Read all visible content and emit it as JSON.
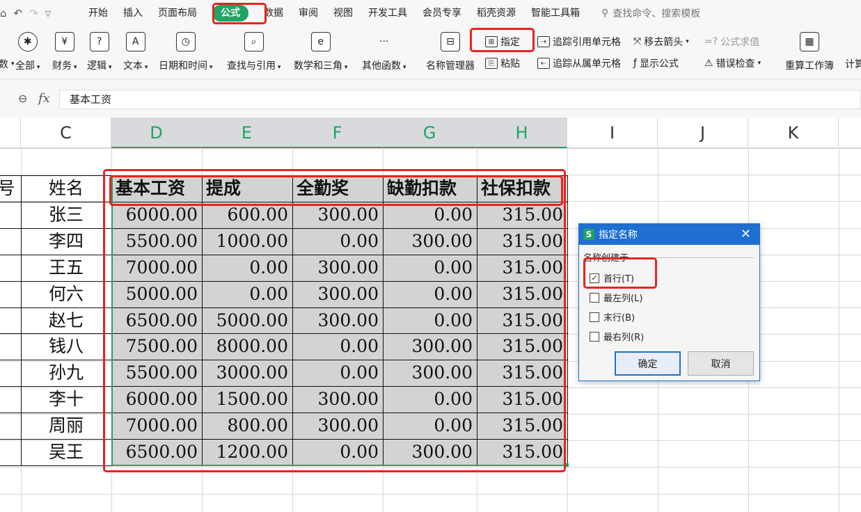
{
  "quick_access": {
    "icons": [
      "save-icon",
      "undo-icon",
      "redo-icon",
      "more-dropdown-icon"
    ]
  },
  "menu": {
    "tabs": [
      "开始",
      "插入",
      "页面布局",
      "公式",
      "数据",
      "审阅",
      "视图",
      "开发工具",
      "会员专享",
      "稻壳资源",
      "智能工具箱"
    ],
    "active_tab": "公式",
    "search_placeholder": "查找命令、搜索模板"
  },
  "ribbon": {
    "cut_label": "数",
    "function_buttons": [
      {
        "label": "全部",
        "icon": "✱"
      },
      {
        "label": "财务",
        "icon": "¥"
      },
      {
        "label": "逻辑",
        "icon": "?"
      },
      {
        "label": "文本",
        "icon": "A"
      },
      {
        "label": "日期和时间",
        "icon": "◷"
      },
      {
        "label": "查找与引用",
        "icon": "⌕"
      },
      {
        "label": "数学和三角",
        "icon": "e"
      },
      {
        "label": "其他函数",
        "icon": "···"
      }
    ],
    "name_manager": "名称管理器",
    "specify": "指定",
    "paste": "粘贴",
    "trace_precedents": "追踪引用单元格",
    "trace_dependents": "追踪从属单元格",
    "remove_arrows": "移去箭头",
    "show_formulas": "显示公式",
    "evaluate_formula": "公式求值",
    "error_check": "错误检查",
    "recalc": "重算工作簿",
    "calc_cut": "计算"
  },
  "formula_bar": {
    "fx": "fx",
    "value": "基本工资"
  },
  "columns": [
    "C",
    "D",
    "E",
    "F",
    "G",
    "H",
    "I",
    "J",
    "K"
  ],
  "sheet": {
    "col_b_header_cut": "号",
    "name_header": "姓名",
    "headers": [
      "基本工资",
      "提成",
      "全勤奖",
      "缺勤扣款",
      "社保扣款"
    ],
    "rows": [
      {
        "name": "张三",
        "vals": [
          "6000.00",
          "600.00",
          "300.00",
          "0.00",
          "315.00"
        ]
      },
      {
        "name": "李四",
        "vals": [
          "5500.00",
          "1000.00",
          "0.00",
          "300.00",
          "315.00"
        ]
      },
      {
        "name": "王五",
        "vals": [
          "7000.00",
          "0.00",
          "300.00",
          "0.00",
          "315.00"
        ]
      },
      {
        "name": "何六",
        "vals": [
          "5000.00",
          "0.00",
          "300.00",
          "0.00",
          "315.00"
        ]
      },
      {
        "name": "赵七",
        "vals": [
          "6500.00",
          "5000.00",
          "300.00",
          "0.00",
          "315.00"
        ]
      },
      {
        "name": "钱八",
        "vals": [
          "7500.00",
          "8000.00",
          "0.00",
          "300.00",
          "315.00"
        ]
      },
      {
        "name": "孙九",
        "vals": [
          "5500.00",
          "3000.00",
          "0.00",
          "300.00",
          "315.00"
        ]
      },
      {
        "name": "李十",
        "vals": [
          "6000.00",
          "1500.00",
          "300.00",
          "0.00",
          "315.00"
        ]
      },
      {
        "name": "周丽",
        "vals": [
          "7000.00",
          "800.00",
          "300.00",
          "0.00",
          "315.00"
        ]
      },
      {
        "name": "吴王",
        "vals": [
          "6500.00",
          "1200.00",
          "0.00",
          "300.00",
          "315.00"
        ]
      }
    ]
  },
  "dialog": {
    "title": "指定名称",
    "group_label": "名称创建于",
    "options": [
      {
        "label": "首行(T)",
        "checked": true
      },
      {
        "label": "最左列(L)",
        "checked": false
      },
      {
        "label": "末行(B)",
        "checked": false
      },
      {
        "label": "最右列(R)",
        "checked": false
      }
    ],
    "ok": "确定",
    "cancel": "取消"
  },
  "colors": {
    "accent": "#1fa463",
    "highlight": "#e8231f",
    "dialog_title": "#1e6fd0"
  }
}
